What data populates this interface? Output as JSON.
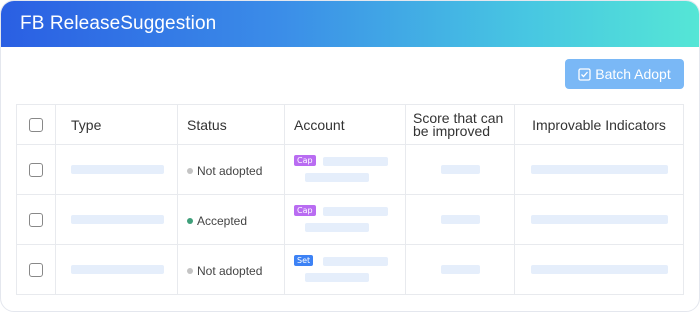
{
  "header": {
    "title": "FB ReleaseSuggestion"
  },
  "toolbar": {
    "batch_adopt_label": "Batch Adopt",
    "batch_adopt_icon": "checklist-icon"
  },
  "table": {
    "columns": [
      "Type",
      "Status",
      "Account",
      "Score that can be improved",
      "Improvable Indicators"
    ],
    "rows": [
      {
        "status": "Not adopted",
        "status_color": "#c4c4c4",
        "account_tag": "Cap",
        "account_tag_color": "#b96cf2"
      },
      {
        "status": "Accepted",
        "status_color": "#3f9f7a",
        "account_tag": "Cap",
        "account_tag_color": "#b96cf2"
      },
      {
        "status": "Not adopted",
        "status_color": "#c4c4c4",
        "account_tag": "Set",
        "account_tag_color": "#3d82f5"
      }
    ]
  },
  "colors": {
    "header_gradient_start": "#2a5fe3",
    "header_gradient_end": "#55e6d6",
    "button_bg": "#7ab8f6",
    "placeholder": "#e5eefb",
    "border": "#e8eaee"
  }
}
